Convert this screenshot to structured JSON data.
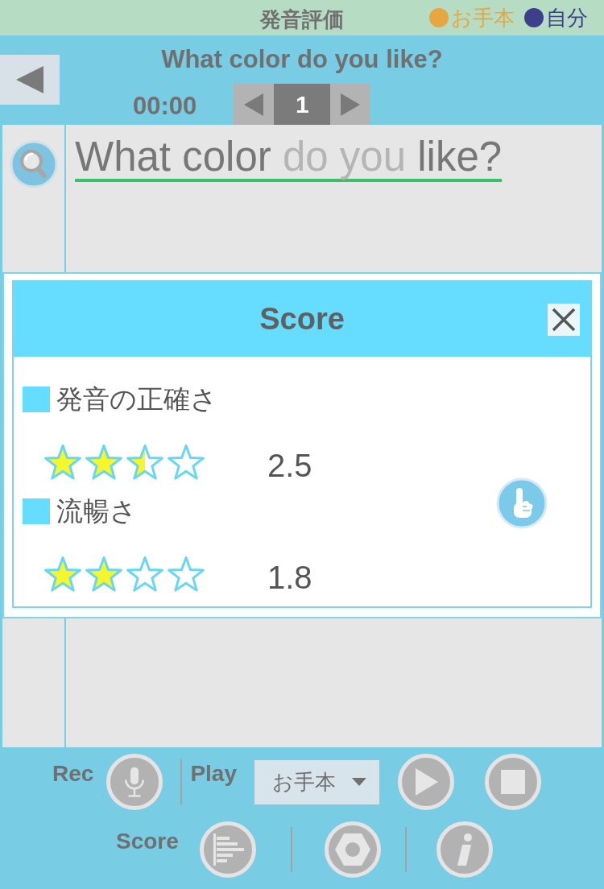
{
  "header": {
    "title": "発音評価",
    "legend": [
      {
        "label": "お手本",
        "color": "#e8a640"
      },
      {
        "label": "自分",
        "color": "#3d3e8c"
      }
    ]
  },
  "nav": {
    "title": "What color do you like?",
    "time": "00:00",
    "page": "1"
  },
  "sentence": {
    "segments": [
      {
        "text": "What color",
        "recognized": true
      },
      {
        "text": "do you",
        "recognized": false
      },
      {
        "text": "like?",
        "recognized": true
      }
    ]
  },
  "dialog": {
    "title": "Score",
    "scores": [
      {
        "label": "発音の正確さ",
        "stars": 2.5,
        "value": "2.5"
      },
      {
        "label": "流暢さ",
        "stars": 2,
        "value": "1.8"
      }
    ]
  },
  "controls": {
    "record_label": "Rec",
    "play_label": "Play",
    "voice_select": {
      "value": "お手本"
    },
    "score_label": "Score"
  }
}
